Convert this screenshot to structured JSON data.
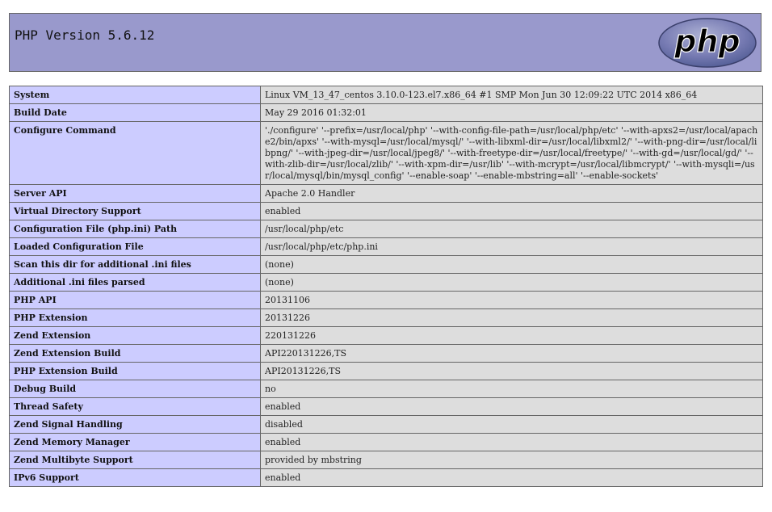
{
  "header": {
    "title": "PHP Version 5.6.12",
    "logo_text": "php"
  },
  "rows": [
    {
      "key": "System",
      "value": "Linux VM_13_47_centos 3.10.0-123.el7.x86_64 #1 SMP Mon Jun 30 12:09:22 UTC 2014 x86_64"
    },
    {
      "key": "Build Date",
      "value": "May 29 2016 01:32:01"
    },
    {
      "key": "Configure Command",
      "value": "'./configure' '--prefix=/usr/local/php' '--with-config-file-path=/usr/local/php/etc' '--with-apxs2=/usr/local/apache2/bin/apxs' '--with-mysql=/usr/local/mysql/' '--with-libxml-dir=/usr/local/libxml2/' '--with-png-dir=/usr/local/libpng/' '--with-jpeg-dir=/usr/local/jpeg8/' '--with-freetype-dir=/usr/local/freetype/' '--with-gd=/usr/local/gd/' '--with-zlib-dir=/usr/local/zlib/' '--with-xpm-dir=/usr/lib' '--with-mcrypt=/usr/local/libmcrypt/' '--with-mysqli=/usr/local/mysql/bin/mysql_config' '--enable-soap' '--enable-mbstring=all' '--enable-sockets'"
    },
    {
      "key": "Server API",
      "value": "Apache 2.0 Handler"
    },
    {
      "key": "Virtual Directory Support",
      "value": "enabled"
    },
    {
      "key": "Configuration File (php.ini) Path",
      "value": "/usr/local/php/etc"
    },
    {
      "key": "Loaded Configuration File",
      "value": "/usr/local/php/etc/php.ini"
    },
    {
      "key": "Scan this dir for additional .ini files",
      "value": "(none)"
    },
    {
      "key": "Additional .ini files parsed",
      "value": "(none)"
    },
    {
      "key": "PHP API",
      "value": "20131106"
    },
    {
      "key": "PHP Extension",
      "value": "20131226"
    },
    {
      "key": "Zend Extension",
      "value": "220131226"
    },
    {
      "key": "Zend Extension Build",
      "value": "API220131226,TS"
    },
    {
      "key": "PHP Extension Build",
      "value": "API20131226,TS"
    },
    {
      "key": "Debug Build",
      "value": "no"
    },
    {
      "key": "Thread Safety",
      "value": "enabled"
    },
    {
      "key": "Zend Signal Handling",
      "value": "disabled"
    },
    {
      "key": "Zend Memory Manager",
      "value": "enabled"
    },
    {
      "key": "Zend Multibyte Support",
      "value": "provided by mbstring"
    },
    {
      "key": "IPv6 Support",
      "value": "enabled"
    }
  ]
}
